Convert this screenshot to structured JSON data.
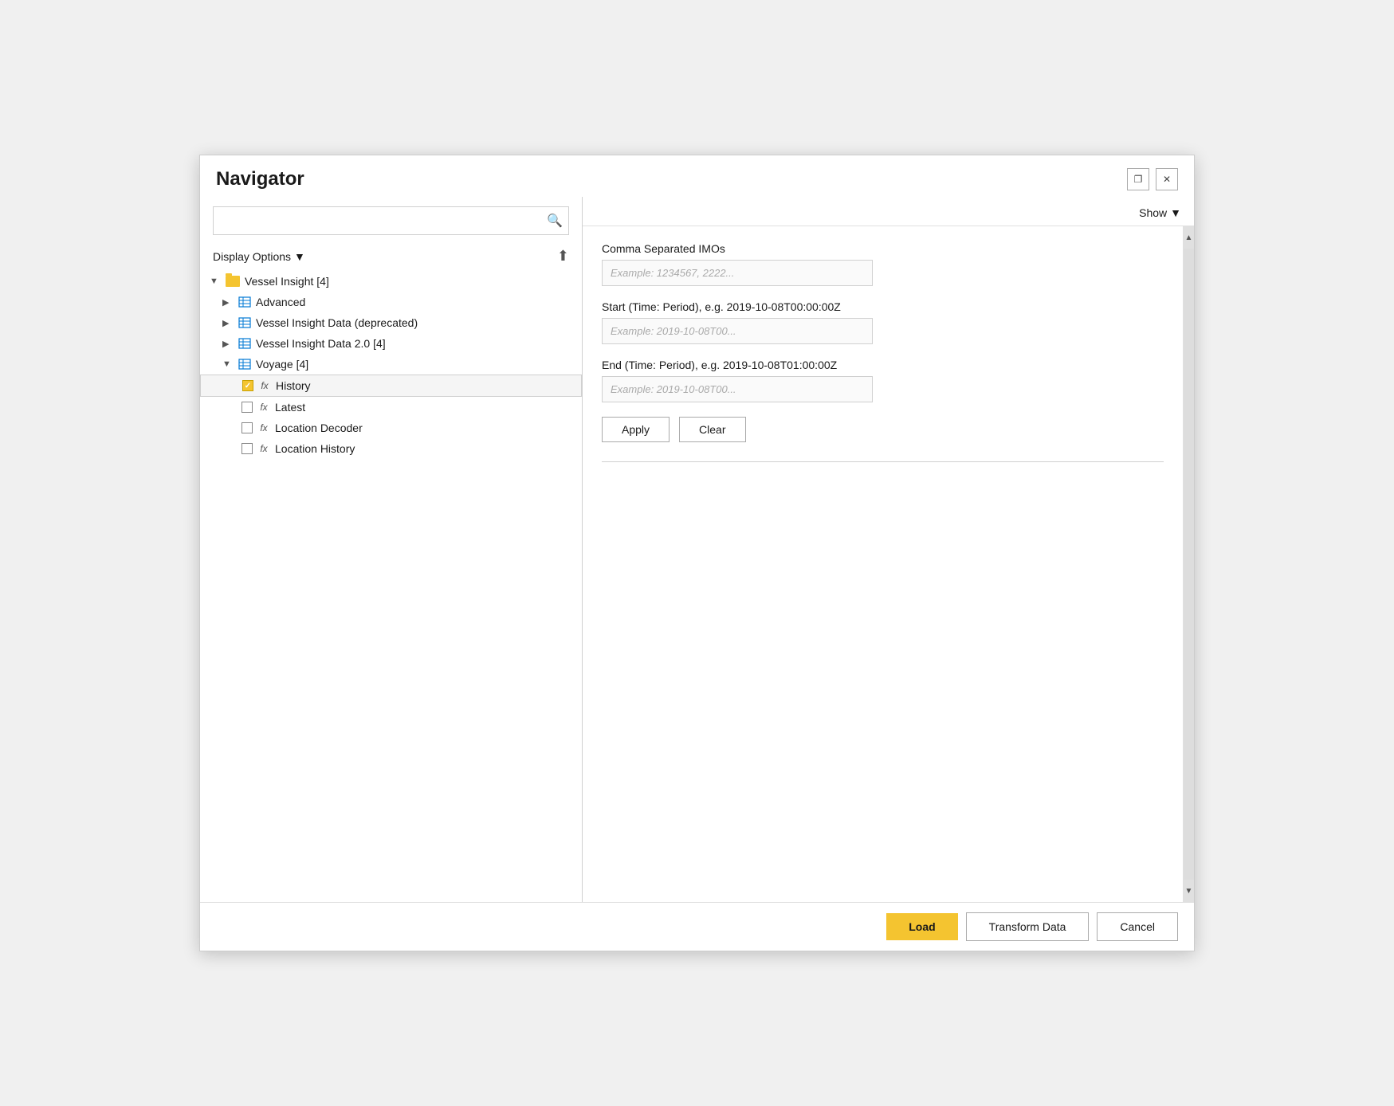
{
  "dialog": {
    "title": "Navigator"
  },
  "titlebar": {
    "restore_label": "❐",
    "close_label": "✕"
  },
  "search": {
    "placeholder": "",
    "search_icon": "🔍"
  },
  "display_options": {
    "label": "Display Options",
    "chevron": "▼"
  },
  "show_btn": {
    "label": "Show",
    "chevron": "▼"
  },
  "tree": {
    "root": {
      "label": "Vessel Insight [4]",
      "expanded": true,
      "children": [
        {
          "label": "Advanced",
          "type": "table",
          "expanded": false
        },
        {
          "label": "Vessel Insight Data (deprecated)",
          "type": "table",
          "expanded": false
        },
        {
          "label": "Vessel Insight Data 2.0 [4]",
          "type": "table",
          "expanded": false
        },
        {
          "label": "Voyage [4]",
          "type": "folder",
          "expanded": true,
          "children": [
            {
              "label": "History",
              "type": "function",
              "checked": true,
              "selected": true
            },
            {
              "label": "Latest",
              "type": "function",
              "checked": false
            },
            {
              "label": "Location Decoder",
              "type": "function",
              "checked": false
            },
            {
              "label": "Location History",
              "type": "function",
              "checked": false
            }
          ]
        }
      ]
    }
  },
  "form": {
    "imo_label": "Comma Separated IMOs",
    "imo_placeholder": "Example: 1234567, 2222...",
    "start_label": "Start (Time: Period), e.g. 2019-10-08T00:00:00Z",
    "start_placeholder": "Example: 2019-10-08T00...",
    "end_label": "End (Time: Period), e.g. 2019-10-08T01:00:00Z",
    "end_placeholder": "Example: 2019-10-08T00...",
    "apply_label": "Apply",
    "clear_label": "Clear"
  },
  "footer": {
    "load_label": "Load",
    "transform_label": "Transform Data",
    "cancel_label": "Cancel"
  }
}
